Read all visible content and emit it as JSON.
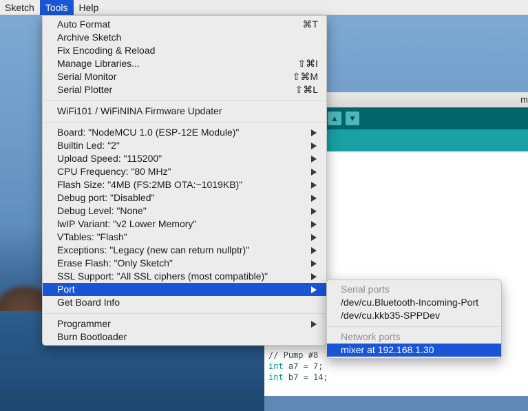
{
  "menubar": {
    "items": [
      "Sketch",
      "Tools",
      "Help"
    ]
  },
  "ide": {
    "title_fragment": "m",
    "toolbar_icons": [
      "upload-icon",
      "download-icon"
    ],
    "code_lines": [
      {
        "text": "// Pump #8",
        "keyword": ""
      },
      {
        "keyword": "int",
        "text": " a7 = 7;"
      },
      {
        "keyword": "int",
        "text": " b7 = 14;"
      }
    ]
  },
  "tools_menu": {
    "group1": [
      {
        "label": "Auto Format",
        "shortcut": "⌘T"
      },
      {
        "label": "Archive Sketch",
        "shortcut": ""
      },
      {
        "label": "Fix Encoding & Reload",
        "shortcut": ""
      },
      {
        "label": "Manage Libraries...",
        "shortcut": "⇧⌘I"
      },
      {
        "label": "Serial Monitor",
        "shortcut": "⇧⌘M"
      },
      {
        "label": "Serial Plotter",
        "shortcut": "⇧⌘L"
      }
    ],
    "group2": [
      {
        "label": "WiFi101 / WiFiNINA Firmware Updater"
      }
    ],
    "group3": [
      {
        "label": "Board: \"NodeMCU 1.0 (ESP-12E Module)\""
      },
      {
        "label": "Builtin Led: \"2\""
      },
      {
        "label": "Upload Speed: \"115200\""
      },
      {
        "label": "CPU Frequency: \"80 MHz\""
      },
      {
        "label": "Flash Size: \"4MB (FS:2MB OTA:~1019KB)\""
      },
      {
        "label": "Debug port: \"Disabled\""
      },
      {
        "label": "Debug Level: \"None\""
      },
      {
        "label": "lwIP Variant: \"v2 Lower Memory\""
      },
      {
        "label": "VTables: \"Flash\""
      },
      {
        "label": "Exceptions: \"Legacy (new can return nullptr)\""
      },
      {
        "label": "Erase Flash: \"Only Sketch\""
      },
      {
        "label": "SSL Support: \"All SSL ciphers (most compatible)\""
      },
      {
        "label": "Port",
        "highlighted": true
      },
      {
        "label": "Get Board Info"
      }
    ],
    "group4": [
      {
        "label": "Programmer"
      },
      {
        "label": "Burn Bootloader"
      }
    ]
  },
  "port_submenu": {
    "serial_header": "Serial ports",
    "serial_ports": [
      "/dev/cu.Bluetooth-Incoming-Port",
      "/dev/cu.kkb35-SPPDev"
    ],
    "network_header": "Network ports",
    "network_ports": [
      "mixer at 192.168.1.30"
    ]
  },
  "colors": {
    "highlight": "#1a55d6",
    "ide_toolbar": "#006468",
    "ide_tabs": "#17a1a5"
  }
}
